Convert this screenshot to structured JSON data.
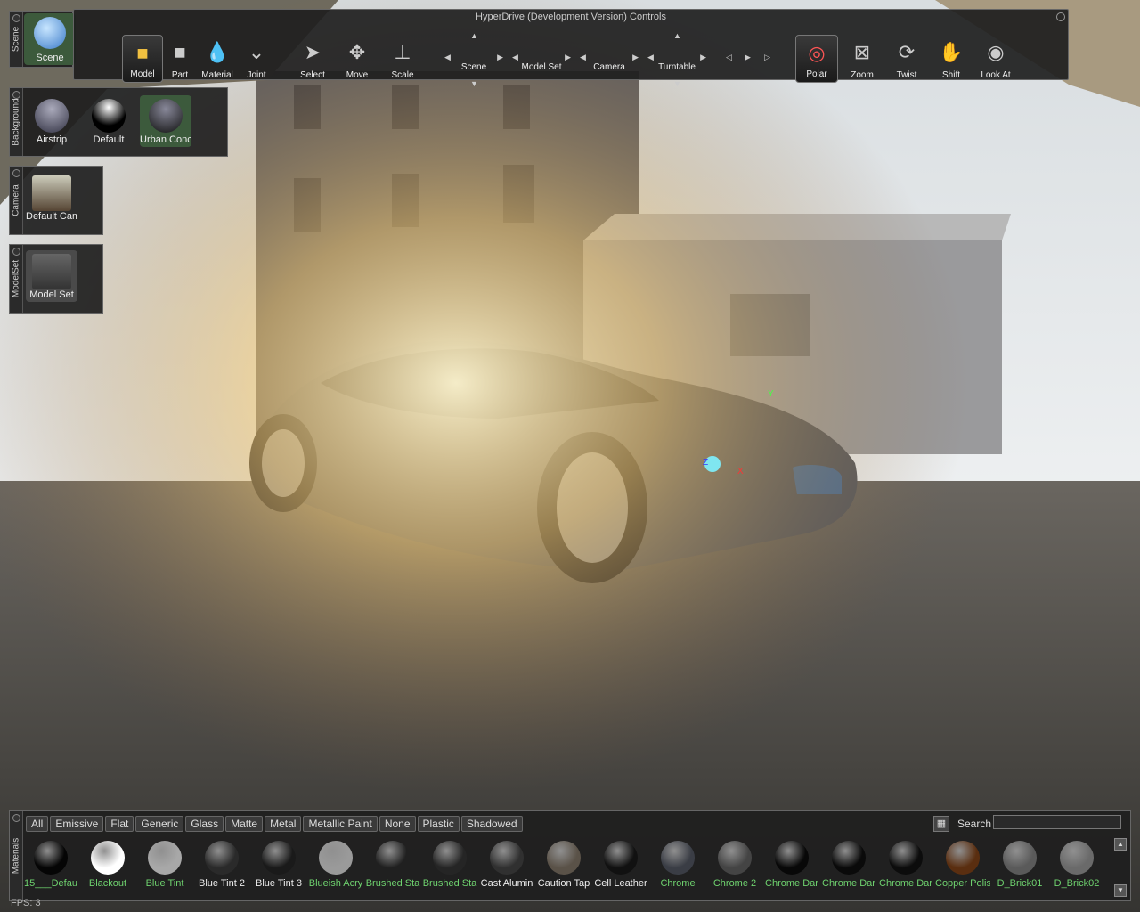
{
  "window": {
    "title": "HyperDrive (Development Version) Controls"
  },
  "toolbar": {
    "scene_tab": "Scene",
    "scene_btn": "Scene",
    "tools": [
      "Model",
      "Part",
      "Material",
      "Joint",
      "Select",
      "Move",
      "Scale"
    ],
    "nav": [
      "Scene",
      "Model Set",
      "Camera",
      "Turntable"
    ],
    "camera_modes": [
      "Polar",
      "Zoom",
      "Twist",
      "Shift",
      "Look At"
    ]
  },
  "background_panel": {
    "tab": "Background",
    "items": [
      "Airstrip",
      "Default",
      "Urban Conc"
    ]
  },
  "camera_panel": {
    "tab": "Camera",
    "items": [
      "Default Cam"
    ]
  },
  "modelset_panel": {
    "tab": "ModelSet",
    "items": [
      "Model Set"
    ]
  },
  "materials": {
    "tab": "Materials",
    "filters": [
      "All",
      "Emissive",
      "Flat",
      "Generic",
      "Glass",
      "Matte",
      "Metal",
      "Metallic Paint",
      "None",
      "Plastic",
      "Shadowed"
    ],
    "search_label": "Search",
    "search_value": "",
    "items": [
      {
        "name": "15___Defau",
        "green": true,
        "color": "#050505"
      },
      {
        "name": "Blackout",
        "green": true,
        "color": "#ffffff"
      },
      {
        "name": "Blue Tint",
        "green": true,
        "color": "#a8a8a8"
      },
      {
        "name": "Blue Tint 2",
        "green": false,
        "color": "#2a2a2a"
      },
      {
        "name": "Blue Tint 3",
        "green": false,
        "color": "#1a1a1a"
      },
      {
        "name": "Blueish Acry",
        "green": true,
        "color": "#9a9a9a"
      },
      {
        "name": "Brushed Sta",
        "green": true,
        "color": "#202020"
      },
      {
        "name": "Brushed Sta",
        "green": true,
        "color": "#252525"
      },
      {
        "name": "Cast Alumin",
        "green": false,
        "color": "#303030"
      },
      {
        "name": "Caution Tap",
        "green": false,
        "color": "#5a5248"
      },
      {
        "name": "Cell Leather",
        "green": false,
        "color": "#111111"
      },
      {
        "name": "Chrome",
        "green": true,
        "color": "#3a3d45"
      },
      {
        "name": "Chrome 2",
        "green": true,
        "color": "#444444"
      },
      {
        "name": "Chrome Dar",
        "green": true,
        "color": "#080808"
      },
      {
        "name": "Chrome Dar",
        "green": true,
        "color": "#0a0a0a"
      },
      {
        "name": "Chrome Dar",
        "green": true,
        "color": "#0c0c0c"
      },
      {
        "name": "Copper Polis",
        "green": true,
        "color": "#5a2e10"
      },
      {
        "name": "D_Brick01",
        "green": true,
        "color": "#5a5a5a"
      },
      {
        "name": "D_Brick02",
        "green": true,
        "color": "#6a6a6a"
      }
    ]
  },
  "status": {
    "fps": "FPS: 3"
  },
  "gizmo": {
    "x": "X",
    "y": "Y",
    "z": "Z"
  }
}
